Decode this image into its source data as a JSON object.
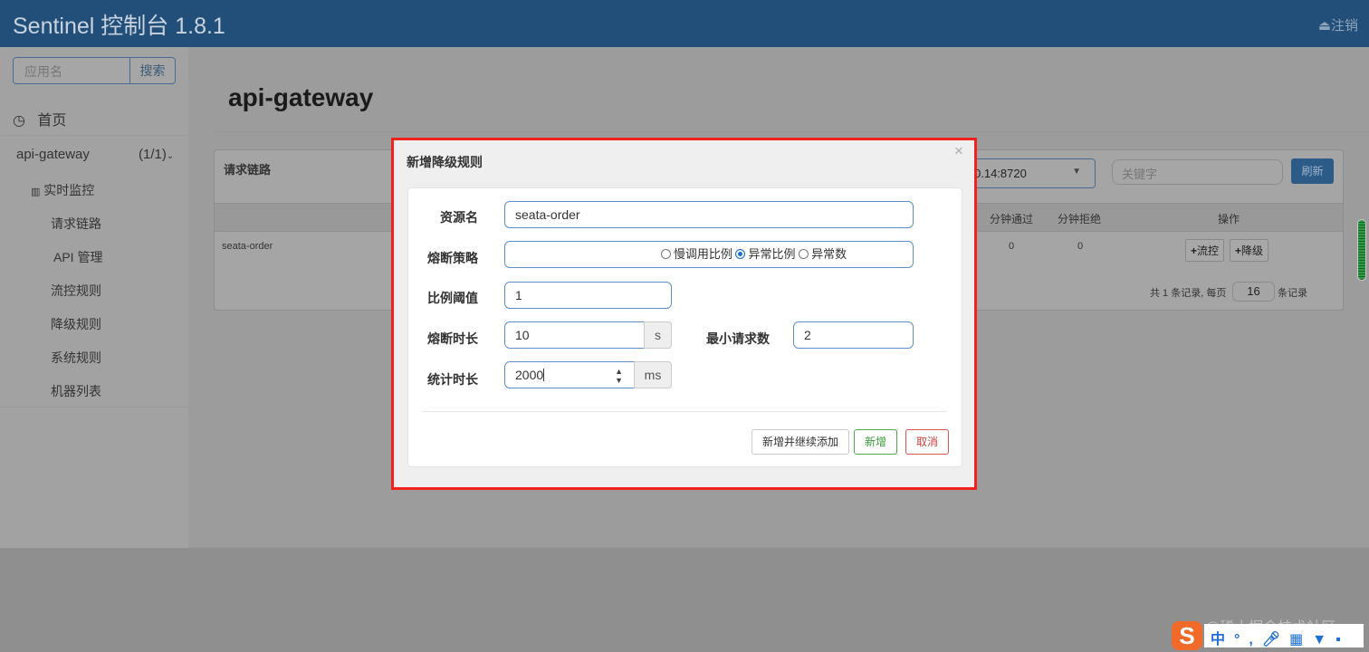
{
  "header": {
    "brand": "Sentinel 控制台 1.8.1",
    "logout": "注销"
  },
  "sidebar": {
    "search_placeholder": "应用名",
    "search_button": "搜索",
    "home": "首页",
    "app": {
      "name": "api-gateway",
      "count": "(1/1)"
    },
    "items": [
      {
        "label": "实时监控"
      },
      {
        "label": "请求链路"
      },
      {
        "label": "API 管理"
      },
      {
        "label": "流控规则"
      },
      {
        "label": "降级规则"
      },
      {
        "label": "系统规则"
      },
      {
        "label": "机器列表"
      }
    ]
  },
  "main": {
    "title": "api-gateway",
    "panel_title": "请求链路",
    "machine_select": "0.14:8720",
    "keyword_placeholder": "关键字",
    "refresh": "刷新",
    "columns": {
      "pass": "分钟通过",
      "block": "分钟拒绝",
      "ops": "操作"
    },
    "rows": [
      {
        "resource": "seata-order",
        "pass": "0",
        "block": "0"
      }
    ],
    "row_actions": {
      "flow": "流控",
      "degrade": "降级"
    },
    "pagination": {
      "prefix": "共 1 条记录, 每页",
      "page_size": "16",
      "suffix": "条记录"
    }
  },
  "modal": {
    "title": "新增降级规则",
    "resource_label": "资源名",
    "resource_value": "seata-order",
    "strategy_label": "熔断策略",
    "strategies": [
      "慢调用比例",
      "异常比例",
      "异常数"
    ],
    "selected_strategy": "异常比例",
    "threshold_label": "比例阈值",
    "threshold_value": "1",
    "duration_label": "熔断时长",
    "duration_value": "10",
    "duration_unit": "s",
    "min_req_label": "最小请求数",
    "min_req_value": "2",
    "stat_label": "统计时长",
    "stat_value": "2000",
    "stat_unit": "ms",
    "btn_add_continue": "新增并继续添加",
    "btn_add": "新增",
    "btn_cancel": "取消"
  },
  "watermark": "@稀土掘金技术社区",
  "ime": {
    "lang": "中"
  }
}
